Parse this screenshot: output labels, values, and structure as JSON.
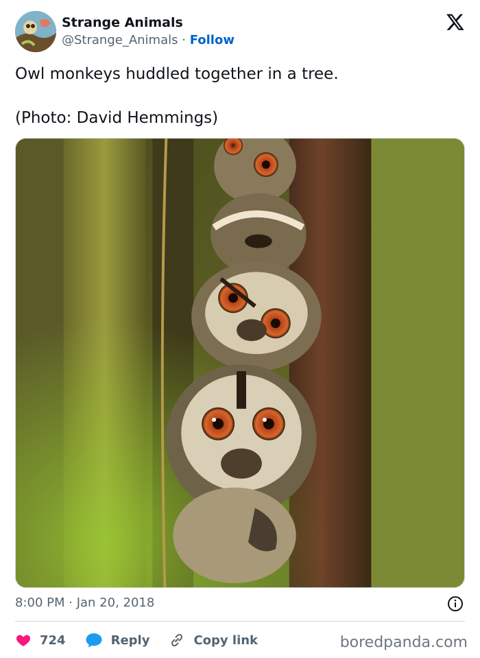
{
  "author": {
    "display_name": "Strange Animals",
    "handle": "@Strange_Animals",
    "separator": "·",
    "follow_label": "Follow"
  },
  "tweet": {
    "text": "Owl monkeys huddled together in a tree.\n\n(Photo: David Hemmings)",
    "timestamp": "8:00 PM · Jan 20, 2018"
  },
  "actions": {
    "likes": "724",
    "reply_label": "Reply",
    "copy_link_label": "Copy link"
  },
  "watermark": "boredpanda.com",
  "colors": {
    "like": "#f91880",
    "reply": "#1d9bf0",
    "follow": "#0063c9",
    "muted": "#536471"
  },
  "icons": [
    "x-logo-icon",
    "heart-icon",
    "reply-bubble-icon",
    "link-icon",
    "info-icon"
  ]
}
